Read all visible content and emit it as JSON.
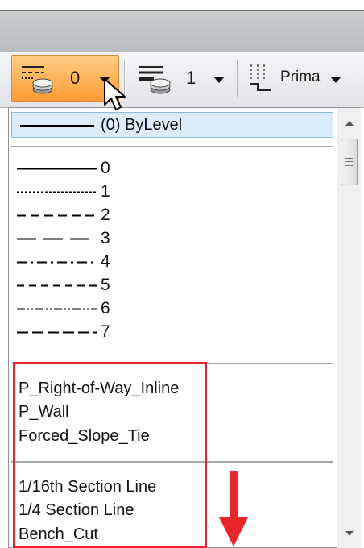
{
  "toolbar": {
    "line_style_button": {
      "value": "0",
      "icon": "line-style-icon"
    },
    "line_weight_button": {
      "value": "1",
      "icon": "line-weight-icon"
    },
    "level_button": {
      "label": "Prima",
      "icon": "level-line-icon"
    }
  },
  "dropdown": {
    "selected": {
      "label": "(0) ByLevel"
    },
    "line_styles": [
      {
        "number": "0",
        "pattern": "solid"
      },
      {
        "number": "1",
        "pattern": "dotted"
      },
      {
        "number": "2",
        "pattern": "short-dash"
      },
      {
        "number": "3",
        "pattern": "long-dash"
      },
      {
        "number": "4",
        "pattern": "dash-dot"
      },
      {
        "number": "5",
        "pattern": "medium-dash"
      },
      {
        "number": "6",
        "pattern": "dash-dot-dot"
      },
      {
        "number": "7",
        "pattern": "dash-space"
      }
    ],
    "custom_group_1": [
      "P_Right-of-Way_Inline",
      "P_Wall",
      "Forced_Slope_Tie"
    ],
    "custom_group_2": [
      "1/16th Section Line",
      "1/4 Section Line",
      "Bench_Cut"
    ]
  },
  "annotation": {
    "box_color": "#e8252b",
    "arrow_color": "#e8252b"
  },
  "colors": {
    "active_button": "#ffa94d",
    "selected_row": "#ddecfa"
  }
}
